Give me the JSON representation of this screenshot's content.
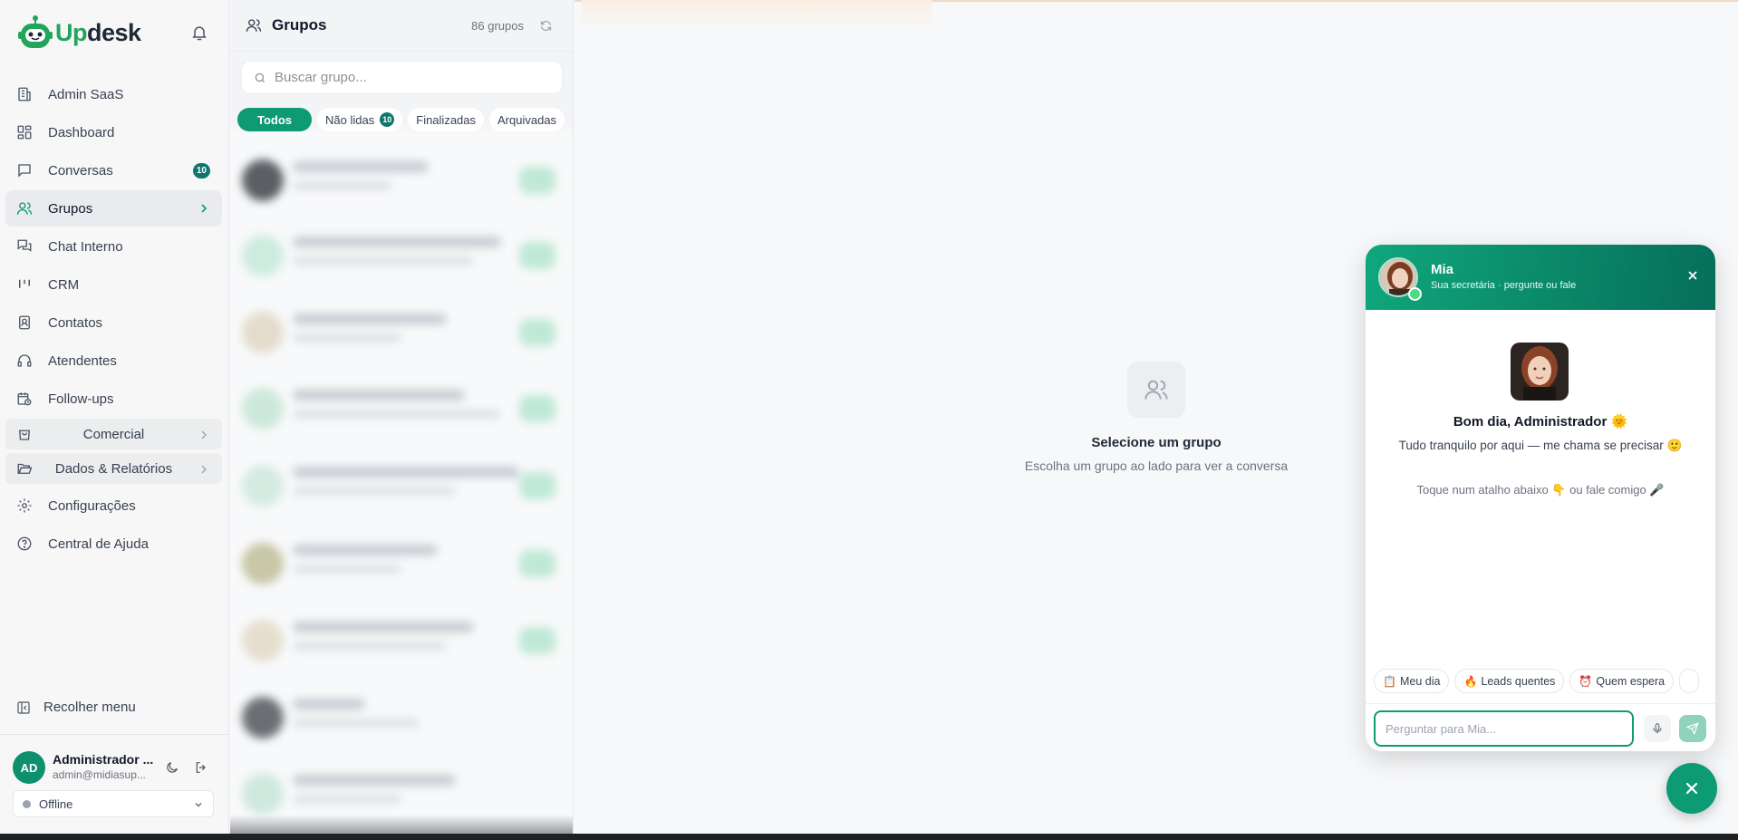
{
  "brand": {
    "name_a": "Up",
    "name_b": "desk"
  },
  "nav": {
    "items": [
      {
        "label": "Admin SaaS",
        "icon": "building-icon"
      },
      {
        "label": "Dashboard",
        "icon": "grid-icon"
      },
      {
        "label": "Conversas",
        "icon": "chat-icon",
        "count": "10"
      },
      {
        "label": "Grupos",
        "icon": "users-icon",
        "active": true
      },
      {
        "label": "Chat Interno",
        "icon": "chat-double-icon"
      },
      {
        "label": "CRM",
        "icon": "kanban-icon"
      },
      {
        "label": "Contatos",
        "icon": "contact-book-icon"
      },
      {
        "label": "Atendentes",
        "icon": "headset-icon"
      },
      {
        "label": "Follow-ups",
        "icon": "calendar-clock-icon"
      }
    ],
    "groups": [
      {
        "label": "Comercial",
        "icon": "shopping-bag-icon"
      },
      {
        "label": "Dados & Relatórios",
        "icon": "folder-open-icon"
      }
    ],
    "bottom_items": [
      {
        "label": "Configurações",
        "icon": "gear-icon"
      },
      {
        "label": "Central de Ajuda",
        "icon": "help-circle-icon"
      }
    ],
    "collapse_label": "Recolher menu"
  },
  "user": {
    "initials": "AD",
    "name": "Administrador ...",
    "email": "admin@midiasup...",
    "status": "Offline"
  },
  "groups_panel": {
    "title": "Grupos",
    "count": "86 grupos",
    "search_placeholder": "Buscar grupo...",
    "filters": [
      {
        "label": "Todos",
        "active": true
      },
      {
        "label": "Não lidas",
        "count": "10"
      },
      {
        "label": "Finalizadas"
      },
      {
        "label": "Arquivadas"
      }
    ]
  },
  "main": {
    "empty_title": "Selecione um grupo",
    "empty_subtitle": "Escolha um grupo ao lado para ver a conversa"
  },
  "mia": {
    "name": "Mia",
    "tagline": "Sua secretária · pergunte ou fale",
    "greeting": "Bom dia, Administrador 🌞",
    "message": "Tudo tranquilo por aqui — me chama se precisar 🙂",
    "hint": "Toque num atalho abaixo 👇 ou fale comigo 🎤",
    "quick_actions": [
      {
        "emoji": "📋",
        "label": "Meu dia"
      },
      {
        "emoji": "🔥",
        "label": "Leads quentes"
      },
      {
        "emoji": "⏰",
        "label": "Quem espera"
      }
    ],
    "input_placeholder": "Perguntar para Mia..."
  },
  "colors": {
    "accent": "#0e9a73",
    "badge": "#0f766e",
    "header_gradient_start": "#10a77c",
    "header_gradient_end": "#066e5a"
  }
}
